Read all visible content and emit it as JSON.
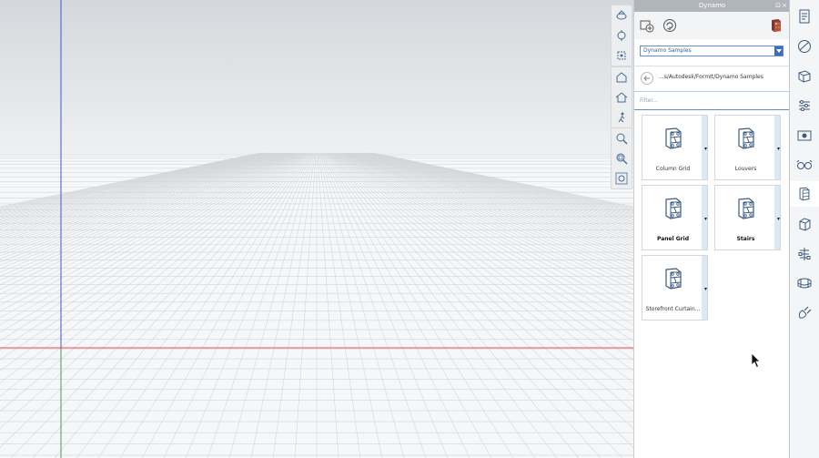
{
  "panel": {
    "title": "Dynamo",
    "restore_symbol": "⊡",
    "close_symbol": "×",
    "toolbar": {
      "new_graph_icon": "new-graph-icon",
      "refresh_icon": "refresh-icon",
      "player_icon": "dynamo-player-icon"
    },
    "dropdown": {
      "selected": "Dynamo Samples",
      "arrow": "▾"
    },
    "path": "...s/Autodesk/FormIt/Dynamo Samples",
    "filter_placeholder": "Filter...",
    "tiles": [
      {
        "label": "Column Grid",
        "caret": "▾",
        "bold": false
      },
      {
        "label": "Louvers",
        "caret": "▾",
        "bold": false
      },
      {
        "label": "Panel Grid",
        "caret": "▾",
        "bold": true
      },
      {
        "label": "Stairs",
        "caret": "▾",
        "bold": true
      },
      {
        "label": "Storefront Curtain...",
        "caret": "▾",
        "bold": false
      }
    ]
  },
  "viewport_tools": [
    [
      "orbit-icon",
      "pan-orbit-icon",
      "look-around-icon"
    ],
    [
      "home-view-icon",
      "house-view-icon",
      "walk-icon"
    ],
    [
      "zoom-icon",
      "zoom-window-icon",
      "zoom-extents-icon"
    ]
  ],
  "right_rail": {
    "items": [
      "properties-icon",
      "materials-icon",
      "layers-icon",
      "levels-icon",
      "scenes-icon",
      "visual-styles-icon",
      "dynamo-icon",
      "groups-icon",
      "hierarchy-icon",
      "content-library-icon",
      "plugin-icon"
    ],
    "active_index": 6
  },
  "colors": {
    "accent": "#3d6db3",
    "axis_x": "#e05050",
    "axis_y": "#4a9a4a",
    "axis_z": "#4455cc"
  }
}
